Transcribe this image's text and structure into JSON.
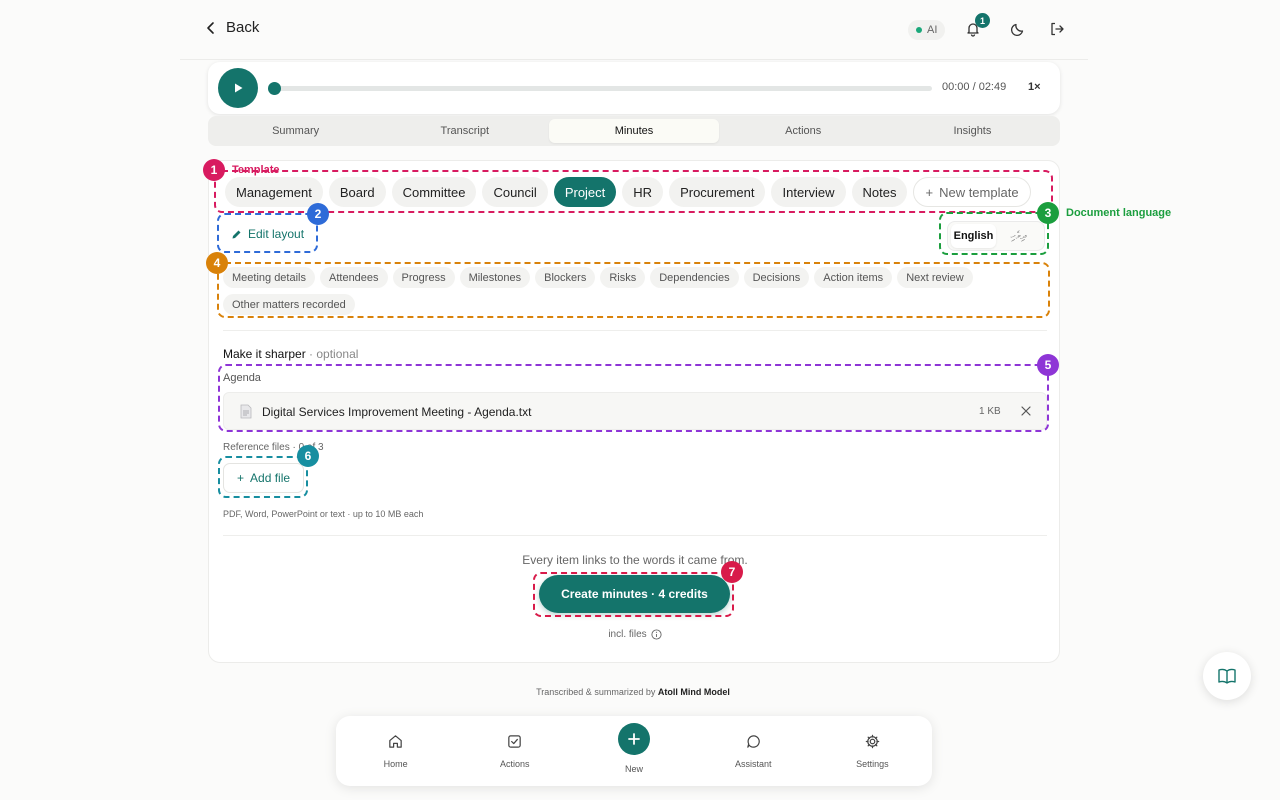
{
  "header": {
    "back_label": "Back",
    "ai_label": "AI",
    "notification_count": "1"
  },
  "player": {
    "time": "00:00 / 02:49",
    "speed": "1×",
    "progress": 0
  },
  "tabs": [
    {
      "label": "Summary",
      "active": false
    },
    {
      "label": "Transcript",
      "active": false
    },
    {
      "label": "Minutes",
      "active": true
    },
    {
      "label": "Actions",
      "active": false
    },
    {
      "label": "Insights",
      "active": false
    }
  ],
  "templates": {
    "items": [
      "Management",
      "Board",
      "Committee",
      "Council",
      "Project",
      "HR",
      "Procurement",
      "Interview",
      "Notes"
    ],
    "active": "Project",
    "new_template_label": "New template"
  },
  "edit_layout_label": "Edit layout",
  "language": {
    "options": [
      "English",
      "ދިވެހި"
    ],
    "active": "English"
  },
  "sections": [
    "Meeting details",
    "Attendees",
    "Progress",
    "Milestones",
    "Blockers",
    "Risks",
    "Dependencies",
    "Decisions",
    "Action items",
    "Next review",
    "Other matters recorded"
  ],
  "sharper": {
    "title": "Make it sharper",
    "optional": "· optional",
    "agenda_label": "Agenda",
    "agenda_file": {
      "name": "Digital Services Improvement Meeting - Agenda.txt",
      "size": "1 KB"
    },
    "reference_label": "Reference files · 0 of 3",
    "add_file_label": "Add file",
    "hint": "PDF, Word, PowerPoint or text · up to 10 MB each"
  },
  "footer_card": {
    "links_text": "Every item links to the words it came from.",
    "create_label": "Create minutes · 4 credits",
    "incl_label": "incl. files"
  },
  "annotations": [
    {
      "num": "1",
      "label": "Template",
      "color": "#d81b60"
    },
    {
      "num": "2",
      "label": "",
      "color": "#2e6bd8"
    },
    {
      "num": "3",
      "label": "Document language",
      "color": "#1b9e3e"
    },
    {
      "num": "4",
      "label": "",
      "color": "#d9820a"
    },
    {
      "num": "5",
      "label": "",
      "color": "#8e35d6"
    },
    {
      "num": "6",
      "label": "",
      "color": "#178ea0"
    },
    {
      "num": "7",
      "label": "",
      "color": "#d81b4a"
    }
  ],
  "credit": {
    "prefix": "Transcribed & summarized by",
    "model": "Atoll Mind Model"
  },
  "bottom_nav": [
    {
      "label": "Home",
      "icon": "home-icon"
    },
    {
      "label": "Actions",
      "icon": "checkbox-icon"
    },
    {
      "label": "New",
      "icon": "plus-icon"
    },
    {
      "label": "Assistant",
      "icon": "chat-icon"
    },
    {
      "label": "Settings",
      "icon": "gear-icon"
    }
  ],
  "colors": {
    "accent": "#14746b"
  }
}
